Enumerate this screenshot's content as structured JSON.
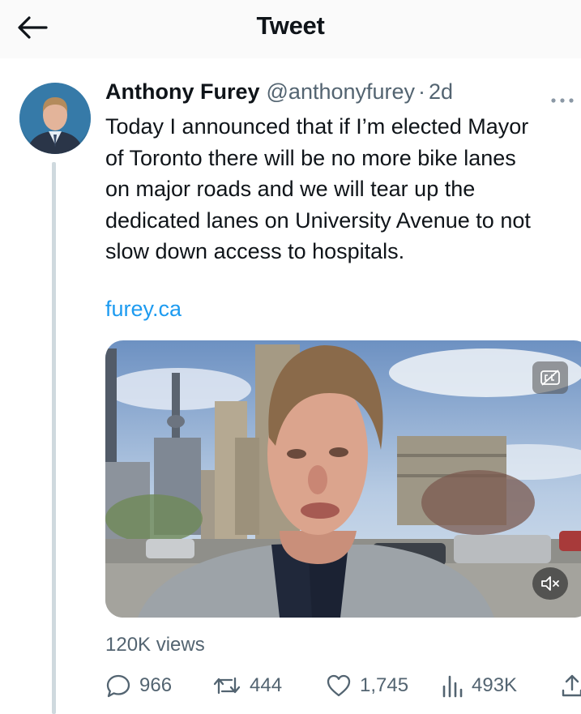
{
  "header": {
    "title": "Tweet",
    "back_icon": "arrow-left-icon"
  },
  "tweet": {
    "author_name": "Anthony Furey",
    "author_handle": "@anthonyfurey",
    "separator": "·",
    "time": "2d",
    "more_icon": "more-dots-icon",
    "text": "Today I announced that if I’m elected Mayor\nof Toronto there will be no more bike lanes\non major roads and we will tear up the\ndedicated lanes on University Avenue to not\nslow down access to hospitals.",
    "link": "furey.ca",
    "media": {
      "type": "video",
      "captions_icon": "captions-off-icon",
      "mute_icon": "muted-speaker-icon"
    },
    "views_label": "120K views"
  },
  "actions": {
    "reply": {
      "icon": "reply-bubble-icon",
      "count": "966"
    },
    "retweet": {
      "icon": "retweet-icon",
      "count": "444"
    },
    "like": {
      "icon": "heart-icon",
      "count": "1,745"
    },
    "views": {
      "icon": "views-bar-chart-icon",
      "count": "493K"
    },
    "share": {
      "icon": "share-icon"
    }
  },
  "colors": {
    "link": "#1d9bf0",
    "secondary_text": "#536471",
    "thread_line": "#cfd9de"
  }
}
